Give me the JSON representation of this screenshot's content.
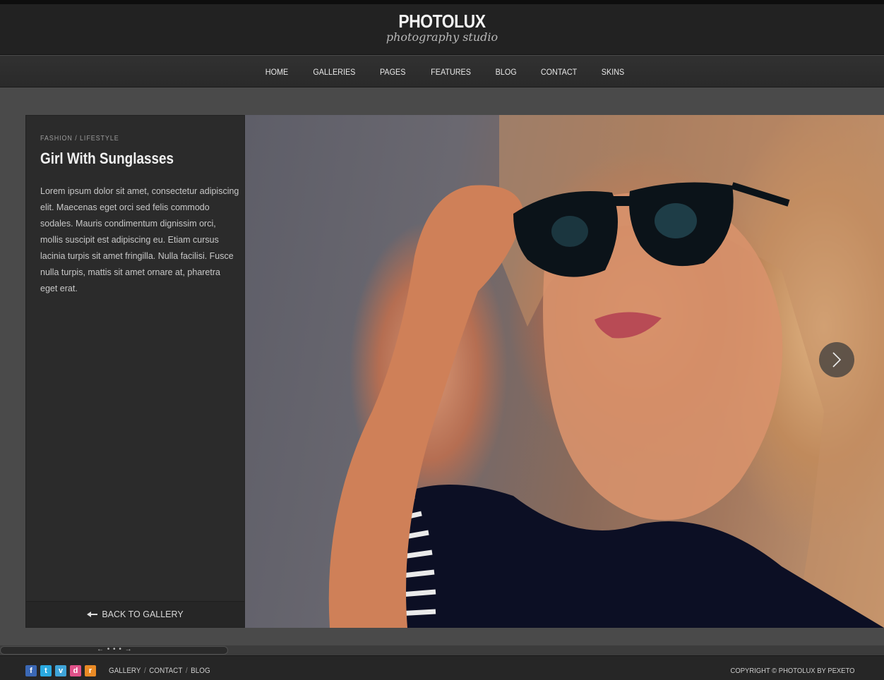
{
  "brand": {
    "title": "PHOTOLUX",
    "subtitle": "photography studio"
  },
  "nav": {
    "items": [
      "HOME",
      "GALLERIES",
      "PAGES",
      "FEATURES",
      "BLOG",
      "CONTACT",
      "SKINS"
    ]
  },
  "post": {
    "category": "FASHION / LIFESTYLE",
    "title": "Girl With Sunglasses",
    "description": "Lorem ipsum dolor sit amet, consectetur adipiscing elit. Maecenas eget orci sed felis commodo sodales. Mauris condimentum dignissim orci, mollis suscipit est adipiscing eu. Etiam cursus lacinia turpis sit amet fringilla. Nulla facilisi. Fusce nulla turpis, mattis sit amet ornare at, pharetra eget erat.",
    "back_label": "BACK TO GALLERY"
  },
  "scroll": {
    "thumb_label": "← • • • →"
  },
  "footer": {
    "social": [
      "f",
      "t",
      "v",
      "d",
      "r"
    ],
    "links": [
      "GALLERY",
      "CONTACT",
      "BLOG"
    ],
    "copyright": "COPYRIGHT © PHOTOLUX BY PEXETO"
  },
  "colors": {
    "background": "#4a4a4a",
    "header": "#222222",
    "sidebar": "#2b2b2b",
    "text": "#dddddd"
  },
  "icons": {
    "back": "arrow-left-icon",
    "next": "chevron-right-icon"
  }
}
